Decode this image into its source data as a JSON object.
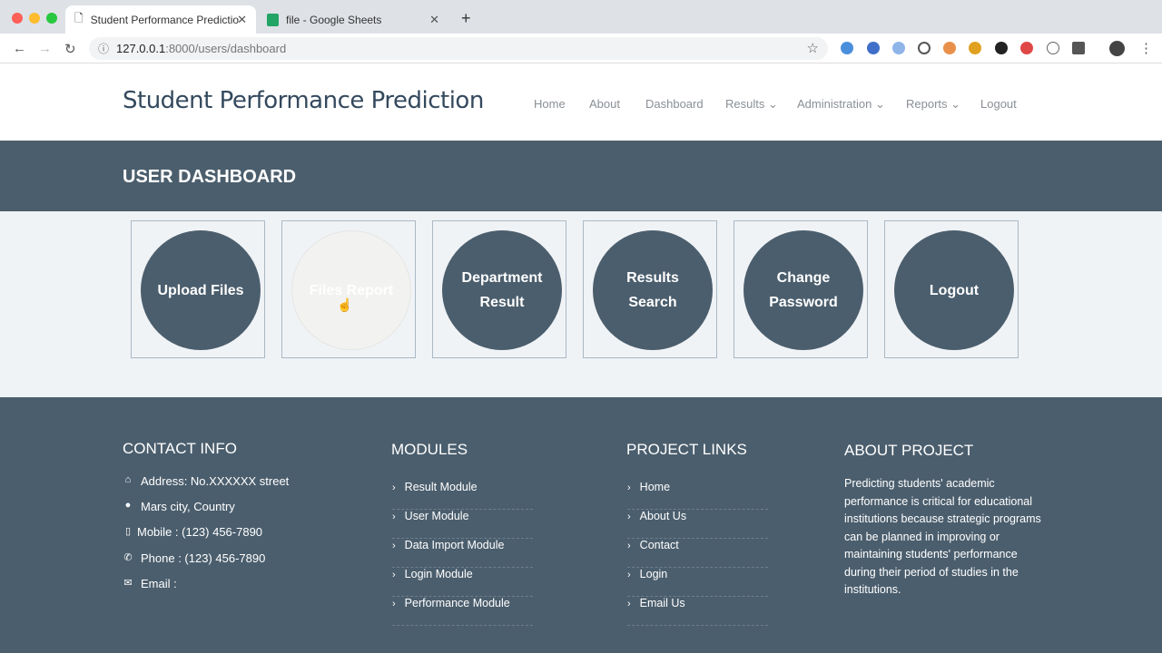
{
  "browser": {
    "tabs": [
      {
        "title": "Student Performance Predictio",
        "active": true
      },
      {
        "title": "file - Google Sheets",
        "active": false
      }
    ],
    "url_host": "127.0.0.1",
    "url_path": ":8000/users/dashboard"
  },
  "header": {
    "brand": "Student Performance Prediction",
    "menu": [
      "Home",
      "About",
      "Dashboard",
      "Results ⌄",
      "Administration ⌄",
      "Reports ⌄",
      "Logout"
    ]
  },
  "banner": {
    "title": "USER DASHBOARD"
  },
  "cards": [
    {
      "label": "Upload Files"
    },
    {
      "label": "Files Report"
    },
    {
      "label": "Department Result"
    },
    {
      "label": "Results Search"
    },
    {
      "label": "Change Password"
    },
    {
      "label": "Logout"
    }
  ],
  "footer": {
    "contact": {
      "title": "CONTACT INFO",
      "items": [
        {
          "icon": "home-icon",
          "text": "Address: No.XXXXXX street"
        },
        {
          "icon": "globe-icon",
          "text": "Mars city, Country"
        },
        {
          "icon": "mobile-icon",
          "text": "Mobile : (123) 456-7890"
        },
        {
          "icon": "phone-icon",
          "text": "Phone : (123) 456-7890"
        },
        {
          "icon": "envelope-icon",
          "text": "Email :"
        }
      ]
    },
    "modules": {
      "title": "MODULES",
      "items": [
        "Result Module",
        "User Module",
        "Data Import Module",
        "Login Module",
        "Performance Module"
      ]
    },
    "links": {
      "title": "PROJECT LINKS",
      "items": [
        "Home",
        "About Us",
        "Contact",
        "Login",
        "Email Us"
      ]
    },
    "about": {
      "title": "ABOUT PROJECT",
      "text": "Predicting students' academic performance is critical for educational institutions because strategic programs can be planned in improving or maintaining students' performance during their period of studies in the institutions."
    }
  },
  "colors": {
    "primary": "#4b5e6d",
    "band": "#4b5e6d",
    "cards_bg": "#f0f3f6"
  }
}
